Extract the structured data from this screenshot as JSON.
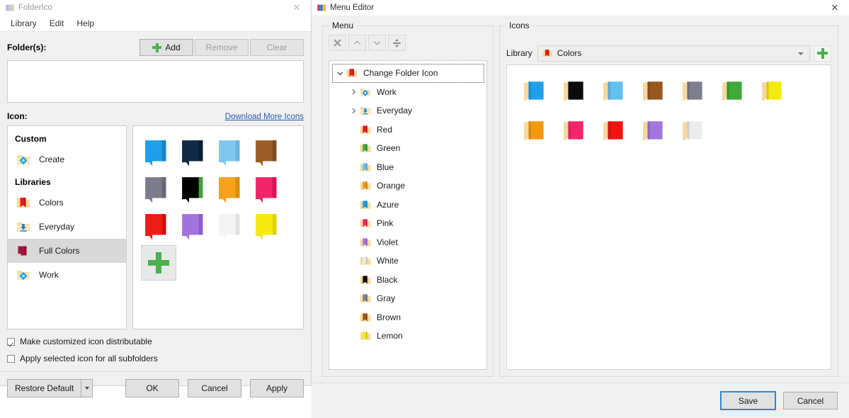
{
  "folderico": {
    "title": "FolderIco",
    "close_label": "✕",
    "menu": [
      "Library",
      "Edit",
      "Help"
    ],
    "folders_label": "Folder(s):",
    "buttons": {
      "add": "Add",
      "remove": "Remove",
      "clear": "Clear"
    },
    "folder_input_value": "",
    "icon_label": "Icon:",
    "download_link": "Download More Icons",
    "custom_group": "Custom",
    "custom_items": [
      {
        "label": "Create",
        "icon": "folder-gear-icon"
      }
    ],
    "libraries_group": "Libraries",
    "libraries": [
      {
        "label": "Colors",
        "icon": "folder-red-icon",
        "selected": false
      },
      {
        "label": "Everyday",
        "icon": "folder-download-icon",
        "selected": false
      },
      {
        "label": "Full Colors",
        "icon": "folder-darkred-solid-icon",
        "selected": true
      },
      {
        "label": "Work",
        "icon": "folder-gear-icon",
        "selected": false
      }
    ],
    "swatches": [
      {
        "name": "azure",
        "color": "#1f9fe8",
        "shade": "#1684c4"
      },
      {
        "name": "navy",
        "color": "#0f2b46",
        "shade": "#0a1e31"
      },
      {
        "name": "light-blue",
        "color": "#7ec8ef",
        "shade": "#66b4de"
      },
      {
        "name": "brown",
        "color": "#9c5d28",
        "shade": "#83491c"
      },
      {
        "name": "gray",
        "color": "#7b7b8c",
        "shade": "#666675"
      },
      {
        "name": "green",
        "color": "#55b council",
        "shade": "#46a03d"
      },
      {
        "name": "orange",
        "color": "#f5a21a",
        "shade": "#dd8c0c"
      },
      {
        "name": "pink",
        "color": "#f4246a",
        "shade": "#d61356"
      },
      {
        "name": "red",
        "color": "#ef1b16",
        "shade": "#d1100c"
      },
      {
        "name": "violet",
        "color": "#a374de",
        "shade": "#8c5ecc"
      },
      {
        "name": "white",
        "color": "#f4f4f4",
        "shade": "#e2e2e2"
      },
      {
        "name": "yellow",
        "color": "#f6ea12",
        "shade": "#ded304"
      }
    ],
    "add_swatch_label": "add-swatch",
    "checkboxes": [
      {
        "label": "Make customized icon distributable",
        "checked": true
      },
      {
        "label": "Apply selected icon for all subfolders",
        "checked": false
      }
    ],
    "restore_default": "Restore Default",
    "footer_buttons": [
      "OK",
      "Cancel",
      "Apply"
    ]
  },
  "menu_editor": {
    "title": "Menu Editor",
    "close_label": "✕",
    "menu_group": "Menu",
    "toolbar": [
      {
        "name": "delete-icon",
        "label": "✕"
      },
      {
        "name": "move-up-icon",
        "label": "⌃"
      },
      {
        "name": "move-down-icon",
        "label": "⌄"
      },
      {
        "name": "add-separator-icon",
        "label": "⇕"
      }
    ],
    "tree": {
      "root": {
        "label": "Change Folder Icon",
        "icon": "folder-red-icon",
        "expanded": true,
        "selected": true
      },
      "children": [
        {
          "label": "Work",
          "icon": "folder-gear-icon",
          "expandable": true
        },
        {
          "label": "Everyday",
          "icon": "folder-download-icon",
          "expandable": true
        },
        {
          "label": "Red",
          "icon": "folder-red-icon",
          "expandable": false
        },
        {
          "label": "Green",
          "icon": "folder-green-icon",
          "expandable": false
        },
        {
          "label": "Blue",
          "icon": "folder-blue-icon",
          "expandable": false
        },
        {
          "label": "Orange",
          "icon": "folder-orange-icon",
          "expandable": false
        },
        {
          "label": "Azure",
          "icon": "folder-azure-icon",
          "expandable": false
        },
        {
          "label": "Pink",
          "icon": "folder-pink-icon",
          "expandable": false
        },
        {
          "label": "Violet",
          "icon": "folder-violet-icon",
          "expandable": false
        },
        {
          "label": "White",
          "icon": "folder-white-icon",
          "expandable": false
        },
        {
          "label": "Black",
          "icon": "folder-black-icon",
          "expandable": false
        },
        {
          "label": "Gray",
          "icon": "folder-gray-icon",
          "expandable": false
        },
        {
          "label": "Brown",
          "icon": "folder-brown-icon",
          "expandable": false
        },
        {
          "label": "Lemon",
          "icon": "folder-lemon-icon",
          "expandable": false
        }
      ]
    },
    "icons_group": "Icons",
    "library_label": "Library",
    "library_value": "Colors",
    "library_icon": "folder-red-icon",
    "add_library_label": "add-library",
    "icon_grid": [
      {
        "name": "azure",
        "color": "#1f9fe8"
      },
      {
        "name": "black",
        "color": "#0c0c0c"
      },
      {
        "name": "light-blue",
        "color": "#64c0ef"
      },
      {
        "name": "brown",
        "color": "#96571f"
      },
      {
        "name": "gray",
        "color": "#7e7e8f"
      },
      {
        "name": "green",
        "color": "#3fa93a"
      },
      {
        "name": "yellow",
        "color": "#f3ea0e"
      },
      {
        "name": "orange",
        "color": "#f2990e"
      },
      {
        "name": "pink",
        "color": "#f4246a"
      },
      {
        "name": "red",
        "color": "#f01510"
      },
      {
        "name": "violet",
        "color": "#a376dc"
      },
      {
        "name": "white",
        "color": "#ededed"
      }
    ],
    "footer_buttons": [
      {
        "label": "Save",
        "focused": true
      },
      {
        "label": "Cancel",
        "focused": false
      }
    ]
  },
  "palette": {
    "accent_blue": "#2a8ad4",
    "link_blue": "#2a5db0",
    "green": "#4caf50",
    "folder_tan": "#f7d99a",
    "window_bg": "#f0f0f0"
  }
}
